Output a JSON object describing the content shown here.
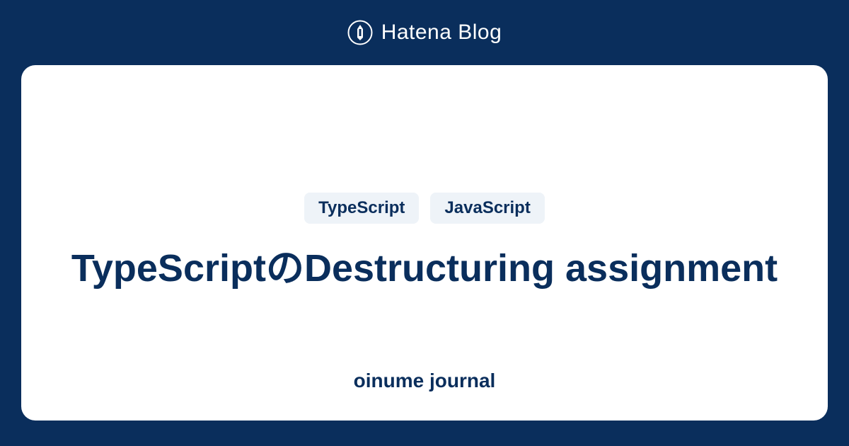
{
  "header": {
    "brand": "Hatena Blog"
  },
  "card": {
    "tags": [
      "TypeScript",
      "JavaScript"
    ],
    "title": "TypeScriptのDestructuring assignment",
    "journal": "oinume journal"
  }
}
